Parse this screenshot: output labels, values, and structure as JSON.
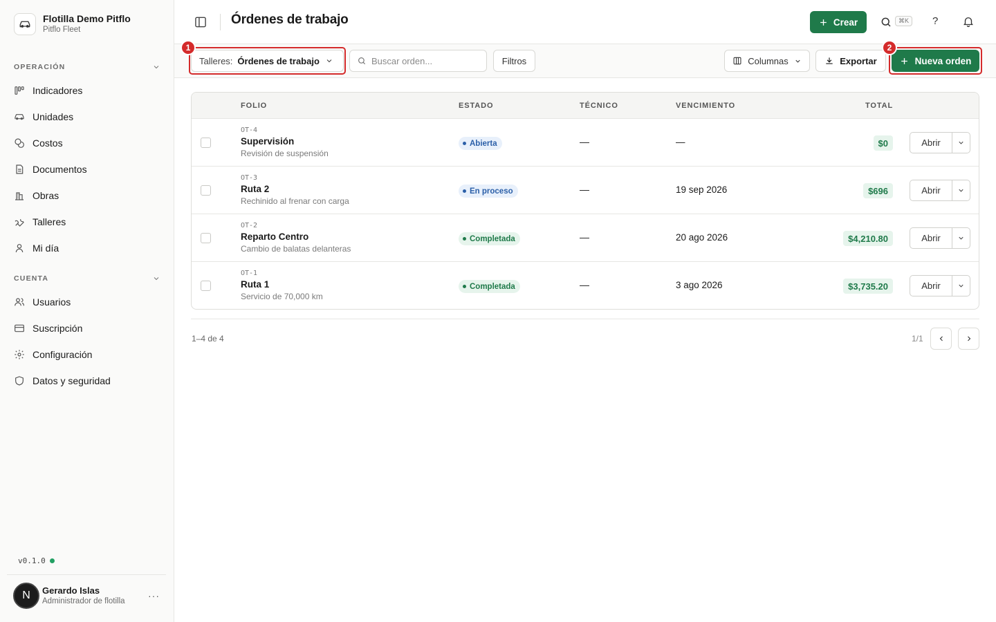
{
  "sidebar": {
    "org_name": "Flotilla Demo Pitflo",
    "org_sub": "Pitflo Fleet",
    "section_operacion": "OPERACIÓN",
    "operacion_items": [
      {
        "label": "Indicadores",
        "icon": "kanban-icon"
      },
      {
        "label": "Unidades",
        "icon": "car-icon"
      },
      {
        "label": "Costos",
        "icon": "coins-icon"
      },
      {
        "label": "Documentos",
        "icon": "document-icon"
      },
      {
        "label": "Obras",
        "icon": "building-icon"
      },
      {
        "label": "Talleres",
        "icon": "wrench-icon"
      },
      {
        "label": "Mi día",
        "icon": "person-icon"
      }
    ],
    "section_cuenta": "CUENTA",
    "cuenta_items": [
      {
        "label": "Usuarios",
        "icon": "users-icon"
      },
      {
        "label": "Suscripción",
        "icon": "credit-card-icon"
      },
      {
        "label": "Configuración",
        "icon": "gear-icon"
      },
      {
        "label": "Datos y seguridad",
        "icon": "shield-icon"
      }
    ],
    "version": "v0.1.0",
    "user": {
      "initial": "N",
      "name": "Gerardo Islas",
      "role": "Administrador de flotilla",
      "more": "···"
    }
  },
  "header": {
    "title": "Órdenes de trabajo",
    "create_label": "Crear",
    "kbd": "⌘K",
    "help": "?"
  },
  "toolbar": {
    "select_label": "Talleres:",
    "select_value": "Órdenes de trabajo",
    "search_placeholder": "Buscar orden...",
    "filters_label": "Filtros",
    "columns_label": "Columnas",
    "export_label": "Exportar",
    "new_order_label": "Nueva orden",
    "badge_1": "1",
    "badge_2": "2"
  },
  "table": {
    "headers": {
      "folio": "FOLIO",
      "estado": "ESTADO",
      "tecnico": "TÉCNICO",
      "vencimiento": "VENCIMIENTO",
      "total": "TOTAL"
    },
    "rows": [
      {
        "code": "OT-4",
        "name": "Supervisión",
        "desc": "Revisión de suspensión",
        "status": "Abierta",
        "status_kind": "open",
        "tech": "—",
        "due": "—",
        "total": "$0",
        "action": "Abrir"
      },
      {
        "code": "OT-3",
        "name": "Ruta 2",
        "desc": "Rechinido al frenar con carga",
        "status": "En proceso",
        "status_kind": "open",
        "tech": "—",
        "due": "19 sep 2026",
        "total": "$696",
        "action": "Abrir"
      },
      {
        "code": "OT-2",
        "name": "Reparto Centro",
        "desc": "Cambio de balatas delanteras",
        "status": "Completada",
        "status_kind": "done",
        "tech": "—",
        "due": "20 ago 2026",
        "total": "$4,210.80",
        "action": "Abrir"
      },
      {
        "code": "OT-1",
        "name": "Ruta 1",
        "desc": "Servicio de 70,000 km",
        "status": "Completada",
        "status_kind": "done",
        "tech": "—",
        "due": "3 ago 2026",
        "total": "$3,735.20",
        "action": "Abrir"
      }
    ]
  },
  "pagination": {
    "range": "1–4 de 4",
    "page": "1/1"
  },
  "colors": {
    "accent": "#1f7a4a",
    "highlight": "#d42b2b",
    "open_status": "#2b5fa8"
  }
}
